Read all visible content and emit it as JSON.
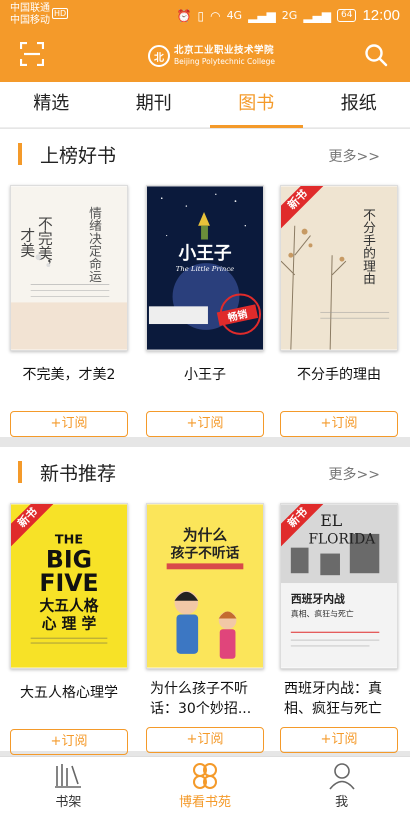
{
  "status_bar": {
    "carrier_1": "中国联通",
    "carrier_2": "中国移动",
    "hd_badge": "HD",
    "net_1": "4G",
    "net_2": "2G",
    "battery": "64",
    "time": "12:00"
  },
  "header": {
    "logo_cn": "北京工业职业技术学院",
    "logo_en": "Beijing Polytechnic College",
    "logo_seal": "北",
    "scan_icon": "scan-icon",
    "search_icon": "search-icon"
  },
  "tabs": [
    {
      "label": "精选",
      "active": false
    },
    {
      "label": "期刊",
      "active": false
    },
    {
      "label": "图书",
      "active": true
    },
    {
      "label": "报纸",
      "active": false
    }
  ],
  "bestsellers": {
    "title": "上榜好书",
    "more": "更多>>",
    "books": [
      {
        "title": "不完美，才美2",
        "button": "+订阅",
        "cover_lines": [
          "不完美，",
          "才美",
          "情绪决定命运"
        ],
        "ribbon": ""
      },
      {
        "title": "小王子",
        "button": "+订阅",
        "cover_lines": [
          "小王子",
          "The Little Prince",
          "畅销"
        ],
        "ribbon": ""
      },
      {
        "title": "不分手的理由",
        "button": "+订阅",
        "cover_lines": [
          "不分手的理由"
        ],
        "ribbon": "新书"
      }
    ]
  },
  "new_books": {
    "title": "新书推荐",
    "more": "更多>>",
    "books": [
      {
        "title": "大五人格心理学",
        "button": "+订阅",
        "cover_lines": [
          "THE",
          "BIG",
          "FIVE",
          "大五人格",
          "心 理 学"
        ],
        "ribbon": "新书"
      },
      {
        "title": "为什么孩子不听话：30个妙招...",
        "button": "+订阅",
        "cover_lines": [
          "为什么",
          "孩子不听话"
        ],
        "ribbon": ""
      },
      {
        "title": "西班牙内战：真相、疯狂与死亡",
        "button": "+订阅",
        "cover_lines": [
          "EL",
          "FLORIDA",
          "西班牙内战",
          "真相、疯狂与死亡"
        ],
        "ribbon": "新书"
      }
    ]
  },
  "bottom_nav": [
    {
      "label": "书架",
      "icon": "bookshelf-icon",
      "active": false
    },
    {
      "label": "博看书苑",
      "icon": "clover-icon",
      "active": true
    },
    {
      "label": "我",
      "icon": "person-icon",
      "active": false
    }
  ],
  "colors": {
    "accent": "#f49a2a",
    "ribbon": "#e02b2b"
  }
}
